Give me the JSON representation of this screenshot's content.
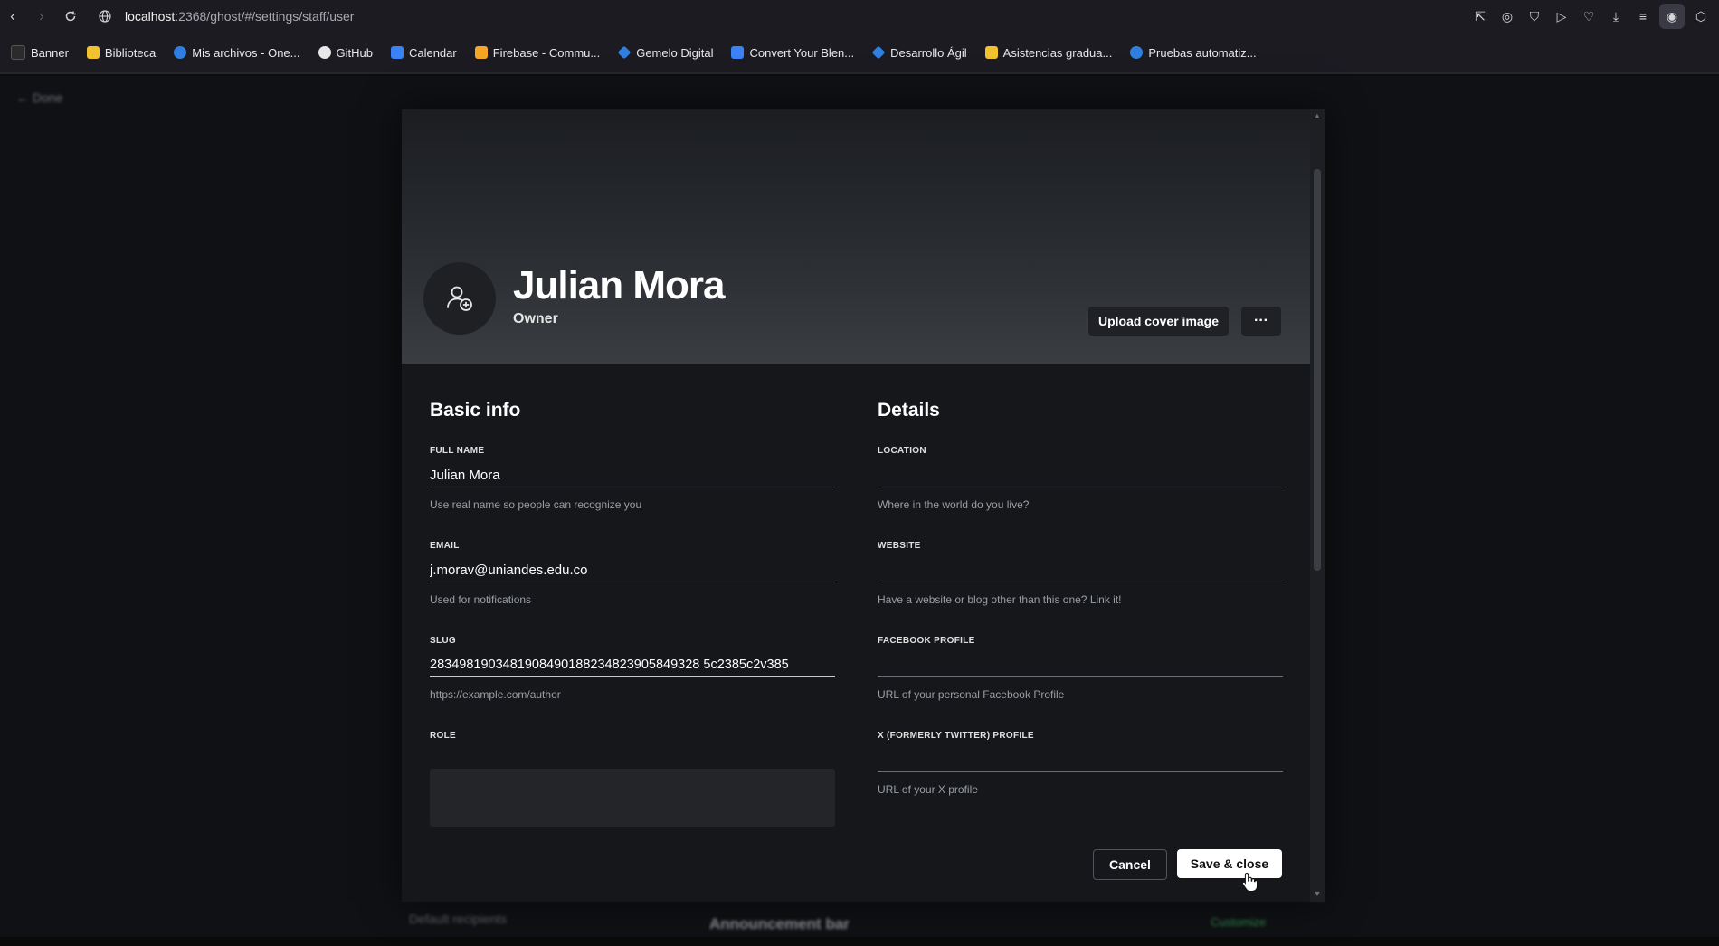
{
  "browser": {
    "url_host": "localhost",
    "url_rest": ":2368/ghost/#/settings/staff/user",
    "bookmarks": [
      {
        "label": "Banner",
        "color": "#2b2b2b"
      },
      {
        "label": "Biblioteca",
        "color": "#f2c12e"
      },
      {
        "label": "Mis archivos - One...",
        "color": "#2f7fe0"
      },
      {
        "label": "GitHub",
        "color": "#e8e8ea"
      },
      {
        "label": "Calendar",
        "color": "#3b82f6"
      },
      {
        "label": "Firebase - Commu...",
        "color": "#f5a623"
      },
      {
        "label": "Gemelo Digital",
        "color": "#2f7fe0"
      },
      {
        "label": "Convert Your Blen...",
        "color": "#3b82f6"
      },
      {
        "label": "Desarrollo Ágil",
        "color": "#2f7fe0"
      },
      {
        "label": "Asistencias gradua...",
        "color": "#f2c12e"
      },
      {
        "label": "Pruebas automatiz...",
        "color": "#2f7fe0"
      }
    ]
  },
  "background": {
    "done_label": "← Done",
    "footer_left": "Default recipients",
    "footer_mid": "Announcement bar",
    "footer_right": "Customize"
  },
  "profile": {
    "name": "Julian Mora",
    "role": "Owner",
    "upload_cover_label": "Upload cover image",
    "more_label": "···"
  },
  "basic_info": {
    "title": "Basic info",
    "full_name_label": "FULL NAME",
    "full_name_value": "Julian Mora",
    "full_name_hint": "Use real name so people can recognize you",
    "email_label": "EMAIL",
    "email_value": "j.morav@uniandes.edu.co",
    "email_hint": "Used for notifications",
    "slug_label": "SLUG",
    "slug_value": "2834981903481908490188234823905849328 5c2385c2v385",
    "slug_hint": "https://example.com/author",
    "role_label": "ROLE"
  },
  "details": {
    "title": "Details",
    "location_label": "LOCATION",
    "location_value": "",
    "location_hint": "Where in the world do you live?",
    "website_label": "WEBSITE",
    "website_value": "",
    "website_hint": "Have a website or blog other than this one? Link it!",
    "facebook_label": "FACEBOOK PROFILE",
    "facebook_value": "",
    "facebook_hint": "URL of your personal Facebook Profile",
    "x_label": "X (FORMERLY TWITTER) PROFILE",
    "x_value": "",
    "x_hint": "URL of your X profile"
  },
  "actions": {
    "cancel_label": "Cancel",
    "save_label": "Save & close"
  }
}
